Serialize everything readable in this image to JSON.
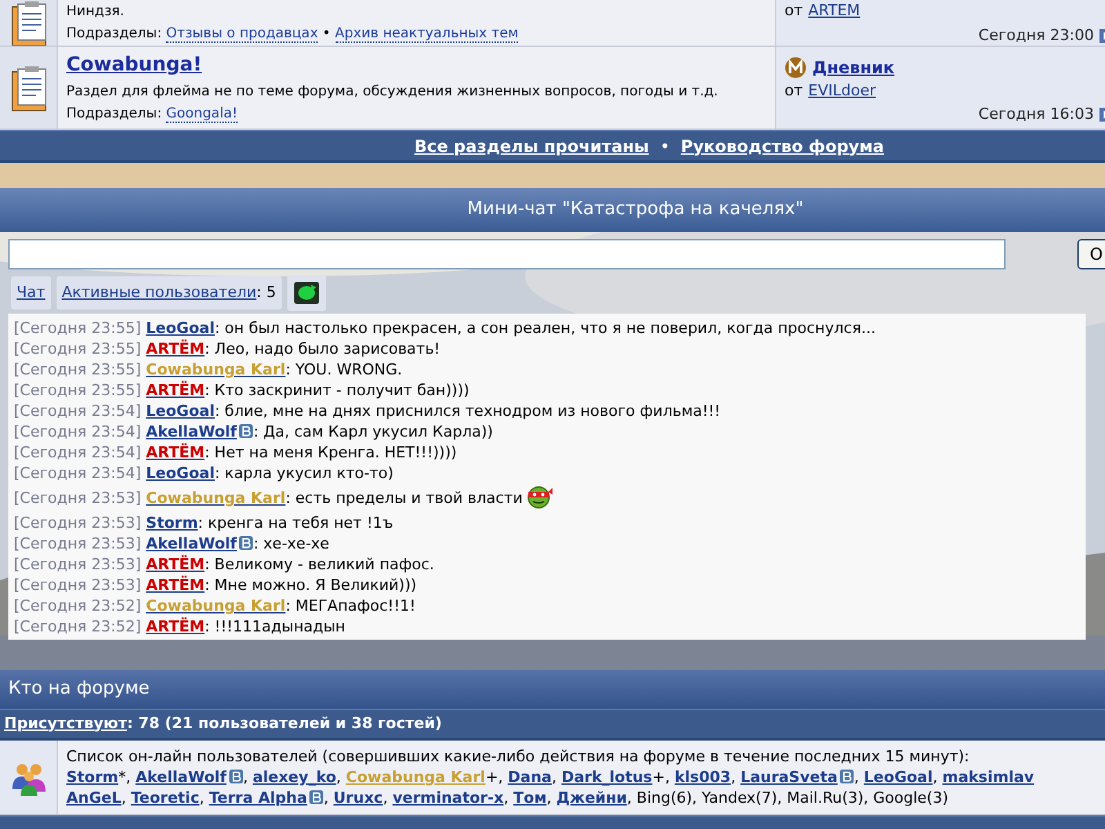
{
  "forums": [
    {
      "description": "Ниндзя.",
      "subsections_label": "Подразделы:",
      "subsections": [
        "Отзывы о продавцах",
        "Архив неактуальных тем"
      ],
      "subsection_separator": "•",
      "last_post": {
        "by_label": "от",
        "author": "ARTEM",
        "time": "Сегодня 23:00"
      }
    },
    {
      "title": "Cowabunga!",
      "description": "Раздел для флейма не по теме форума, обсуждения жизненных вопросов, погоды и т.д.",
      "subsections_label": "Подразделы:",
      "subsections": [
        "Goongala!"
      ],
      "last_post": {
        "topic": "Дневник",
        "by_label": "от",
        "author": "EVILdoer",
        "time": "Сегодня 16:03"
      }
    }
  ],
  "forum_links": [
    "Все разделы прочитаны",
    "Руководство форума"
  ],
  "forum_links_separator": "•",
  "chat": {
    "title": "Мини-чат \"Катастрофа на качелях\"",
    "send_button": "О",
    "tabs": [
      {
        "label": "Чат"
      },
      {
        "label": "Активные пользователи",
        "count_separator": ":",
        "count": "5"
      }
    ],
    "messages": [
      {
        "time": "[Сегодня 23:55]",
        "author": "LeoGoal",
        "color": "#1c3c8c",
        "badge": false,
        "text": ": он был настолько прекрасен, а сон реален, что я не поверил, когда проснулся...",
        "smiley": false
      },
      {
        "time": "[Сегодня 23:55]",
        "author": "ARTЁM",
        "color": "#cc0000",
        "badge": false,
        "text": ": Лео, надо было зарисовать!",
        "smiley": false
      },
      {
        "time": "[Сегодня 23:55]",
        "author": "Cowabunga Karl",
        "color": "#c8a032",
        "badge": false,
        "text": ": YOU. WRONG.",
        "smiley": false
      },
      {
        "time": "[Сегодня 23:55]",
        "author": "ARTЁM",
        "color": "#cc0000",
        "badge": false,
        "text": ": Кто заскринит - получит бан))))",
        "smiley": false
      },
      {
        "time": "[Сегодня 23:54]",
        "author": "LeoGoal",
        "color": "#1c3c8c",
        "badge": false,
        "text": ": блие, мне на днях приснился технодром из нового фильма!!!",
        "smiley": false
      },
      {
        "time": "[Сегодня 23:54]",
        "author": "AkellaWolf",
        "color": "#1c3c8c",
        "badge": true,
        "text": ": Да, сам Карл укусил Карла))",
        "smiley": false
      },
      {
        "time": "[Сегодня 23:54]",
        "author": "ARTЁM",
        "color": "#cc0000",
        "badge": false,
        "text": ": Нет на меня Кренга. НЕТ!!!))))",
        "smiley": false
      },
      {
        "time": "[Сегодня 23:54]",
        "author": "LeoGoal",
        "color": "#1c3c8c",
        "badge": false,
        "text": ": карла укусил кто-то)",
        "smiley": false
      },
      {
        "time": "[Сегодня 23:53]",
        "author": "Cowabunga Karl",
        "color": "#c8a032",
        "badge": false,
        "text": ": есть пределы и твой власти",
        "smiley": true
      },
      {
        "time": "[Сегодня 23:53]",
        "author": "Storm",
        "color": "#1c3c8c",
        "badge": false,
        "text": ": кренга на тебя нет !1ъ",
        "smiley": false
      },
      {
        "time": "[Сегодня 23:53]",
        "author": "AkellaWolf",
        "color": "#1c3c8c",
        "badge": true,
        "text": ": хе-хе-хе",
        "smiley": false
      },
      {
        "time": "[Сегодня 23:53]",
        "author": "ARTЁM",
        "color": "#cc0000",
        "badge": false,
        "text": ": Великому - великий пафос.",
        "smiley": false
      },
      {
        "time": "[Сегодня 23:53]",
        "author": "ARTЁM",
        "color": "#cc0000",
        "badge": false,
        "text": ": Мне можно. Я Великий)))",
        "smiley": false
      },
      {
        "time": "[Сегодня 23:52]",
        "author": "Cowabunga Karl",
        "color": "#c8a032",
        "badge": false,
        "text": ": МЕГАпафос!!1!",
        "smiley": false
      },
      {
        "time": "[Сегодня 23:52]",
        "author": "ARTЁM",
        "color": "#cc0000",
        "badge": false,
        "text": ": !!!111адынадын",
        "smiley": false
      }
    ]
  },
  "who_online": {
    "title": "Кто на форуме",
    "present_label": "Присутствуют",
    "present_text": ": 78 (21 пользователей и 38 гостей)",
    "list_intro": "Список он-лайн пользователей (совершивших какие-либо действия на форуме в течение последних 15 минут):",
    "lines": [
      [
        {
          "name": "Storm",
          "color": "#1c3c8c",
          "badge": false,
          "suffix": "*, "
        },
        {
          "name": "AkellaWolf",
          "color": "#1c3c8c",
          "badge": true,
          "suffix": ", "
        },
        {
          "name": "alexey_ko",
          "color": "#1c3c8c",
          "badge": false,
          "suffix": ", "
        },
        {
          "name": "Cowabunga Karl",
          "color": "#c8a032",
          "badge": false,
          "suffix": "+, "
        },
        {
          "name": "Dana",
          "color": "#1c3c8c",
          "badge": false,
          "suffix": ", "
        },
        {
          "name": "Dark_lotus",
          "color": "#1c3c8c",
          "badge": false,
          "suffix": "+, "
        },
        {
          "name": "kls003",
          "color": "#1c3c8c",
          "badge": false,
          "suffix": ", "
        },
        {
          "name": "LauraSveta",
          "color": "#1c3c8c",
          "badge": true,
          "suffix": ", "
        },
        {
          "name": "LeoGoal",
          "color": "#1c3c8c",
          "badge": false,
          "suffix": ", "
        },
        {
          "name": "maksimlav",
          "color": "#1c3c8c",
          "badge": false
        }
      ],
      [
        {
          "name": "AnGeL",
          "color": "#1c3c8c",
          "badge": false,
          "suffix": ", "
        },
        {
          "name": "Teoretic",
          "color": "#1c3c8c",
          "badge": false,
          "suffix": ", "
        },
        {
          "name": "Terra Alpha",
          "color": "#1c3c8c",
          "badge": true,
          "suffix": ", "
        },
        {
          "name": "Uruxc",
          "color": "#1c3c8c",
          "badge": false,
          "suffix": ", "
        },
        {
          "name": "verminator-x",
          "color": "#1c3c8c",
          "badge": false,
          "suffix": ", "
        },
        {
          "name": "Том",
          "color": "#1c3c8c",
          "badge": false,
          "suffix": ", "
        },
        {
          "name": "Джейни",
          "color": "#1c3c8c",
          "badge": false,
          "suffix": ", "
        }
      ]
    ],
    "bots": "Bing(6), Yandex(7), Mail.Ru(3), Google(3)"
  }
}
